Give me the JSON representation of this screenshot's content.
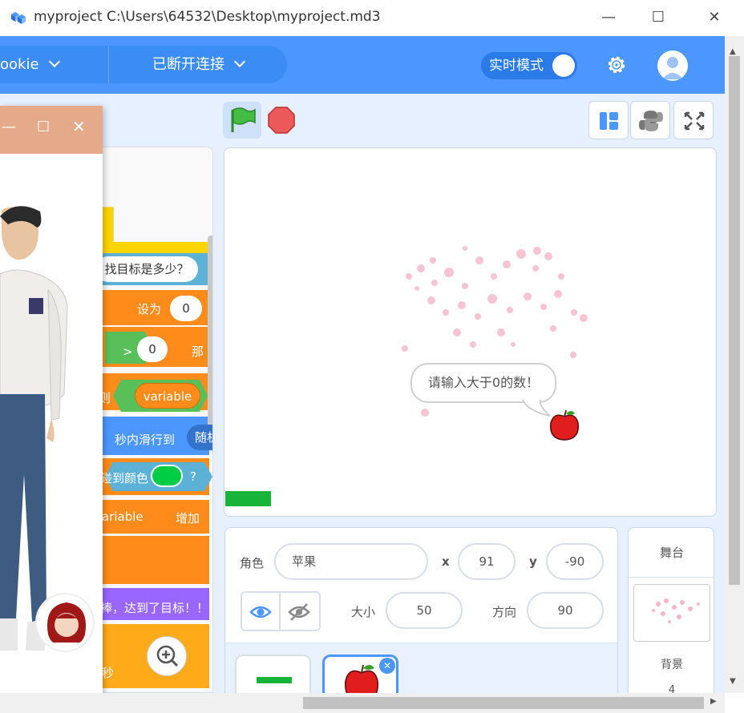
{
  "window": {
    "title": "myproject C:\\Users\\64532\\Desktop\\myproject.md3",
    "minimize_icon": "minimize-icon",
    "maximize_icon": "maximize-icon",
    "close_icon": "close-icon"
  },
  "topbar": {
    "device_label": "ookie",
    "connection_label": "已断开连接",
    "realtime_label": "实时模式",
    "realtime_on": true,
    "accent": "#4c97ff"
  },
  "stage_controls": {
    "flag_icon": "green-flag-icon",
    "stop_icon": "stop-sign-icon",
    "tools": [
      "layout-icon",
      "python-icon",
      "fullscreen-icon"
    ]
  },
  "stage": {
    "speech": "请输入大于0的数！"
  },
  "code_blocks": {
    "ask_text": "找目标是多少？",
    "set_label": "设为",
    "set_value": "0",
    "compare_op": ">",
    "compare_value": "0",
    "then_label": "那",
    "then_prefix": "则",
    "variable_reporter": "variable",
    "glide_label": "秒内滑行到",
    "glide_target": "随机",
    "touch_color_label": "碰到颜色",
    "touch_color_q": "?",
    "change_var": "ariable",
    "change_label": "增加",
    "say_text": "捧，达到了目标！！",
    "wait_label": "秒"
  },
  "sprite_info": {
    "sprite_label": "角色",
    "sprite_name": "苹果",
    "x_label": "x",
    "x_value": "91",
    "y_label": "y",
    "y_value": "-90",
    "size_label": "大小",
    "size_value": "50",
    "direction_label": "方向",
    "direction_value": "90"
  },
  "stage_panel": {
    "title": "舞台",
    "backdrop_label": "背景",
    "backdrop_count": "4"
  }
}
